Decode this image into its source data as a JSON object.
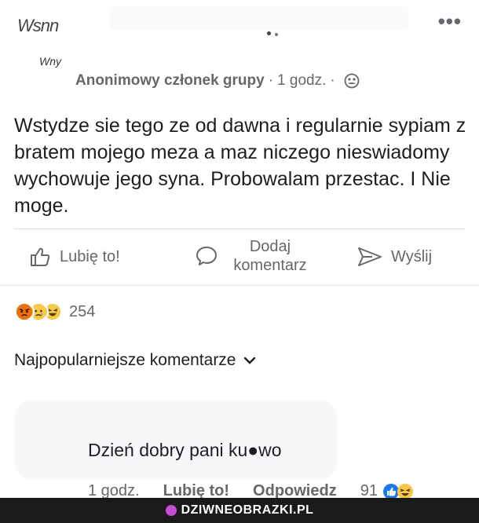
{
  "header": {
    "scribble_name": "Wsnn",
    "scribble_sub": "Wny",
    "more_icon": "more-horizontal-icon"
  },
  "post": {
    "author": "Anonimowy członek grupy",
    "separator": "·",
    "time": "1 godz.",
    "privacy_icon": "group-icon",
    "text": "Wstydze sie tego ze od dawna i regularnie sypiam z bratem mojego meza a maz niczego nieswiadomy wychowuje jego syna. Probowalam przestac. I Nie moge."
  },
  "actions": {
    "like_label": "Lubię to!",
    "comment_label_line1": "Dodaj",
    "comment_label_line2": "komentarz",
    "share_label": "Wyślij"
  },
  "reactions": {
    "icons": [
      "angry-emoji-icon",
      "sad-emoji-icon",
      "haha-emoji-icon"
    ],
    "count": "254"
  },
  "comments": {
    "sort_label": "Najpopularniejsze komentarze",
    "items": [
      {
        "text": "Dzień dobry pani ku●wo",
        "time": "1 godz.",
        "like": "Lubię to!",
        "reply": "Odpowiedz",
        "count": "91"
      }
    ]
  },
  "footer": {
    "watermark": "DZIWNEOBRAZKI.PL"
  },
  "colors": {
    "secondary_text": "#65676b",
    "primary_text": "#1c1e21",
    "like_blue": "#1877f2",
    "footer_bg": "#1a1a1a",
    "watermark_accent": "#c64dd3"
  }
}
